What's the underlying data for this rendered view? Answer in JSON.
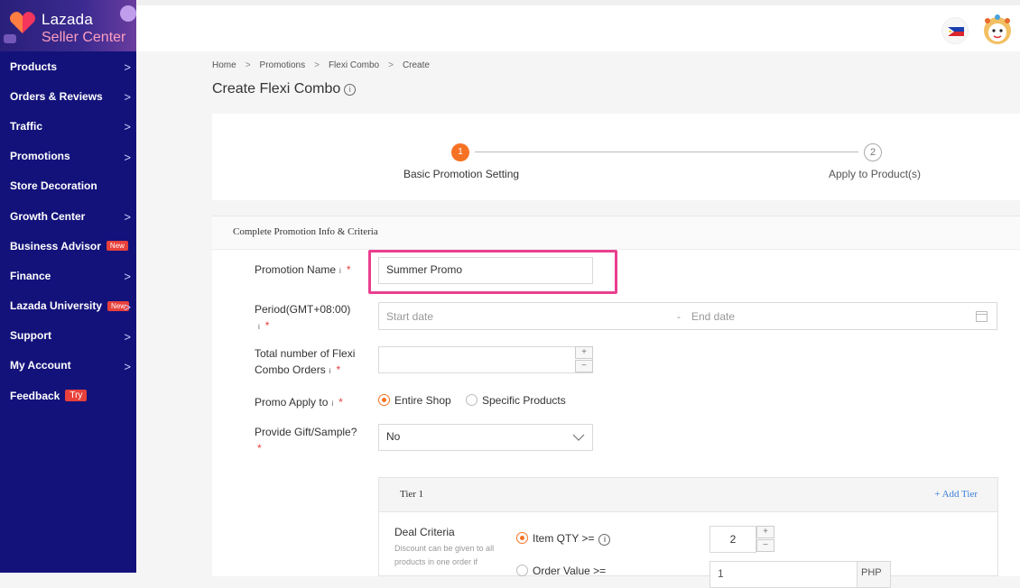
{
  "logo": {
    "line1": "Lazada",
    "line2": "Seller Center"
  },
  "sidebar": {
    "items": [
      {
        "label": "Products",
        "chevron": true
      },
      {
        "label": "Orders & Reviews",
        "chevron": true
      },
      {
        "label": "Traffic",
        "chevron": true
      },
      {
        "label": "Promotions",
        "chevron": true
      },
      {
        "label": "Store Decoration",
        "chevron": false
      },
      {
        "label": "Growth Center",
        "chevron": true
      },
      {
        "label": "Business Advisor",
        "chevron": false,
        "badge": "New"
      },
      {
        "label": "Finance",
        "chevron": true
      },
      {
        "label": "Lazada University",
        "chevron": true,
        "badge": "New"
      },
      {
        "label": "Support",
        "chevron": true
      },
      {
        "label": "My Account",
        "chevron": true
      },
      {
        "label": "Feedback",
        "chevron": false,
        "badge": "Try"
      }
    ]
  },
  "breadcrumb": [
    "Home",
    "Promotions",
    "Flexi Combo",
    "Create"
  ],
  "page_title": "Create Flexi Combo",
  "steps": {
    "step1": {
      "num": "1",
      "label": "Basic Promotion Setting"
    },
    "step2": {
      "num": "2",
      "label": "Apply to Product(s)"
    }
  },
  "form": {
    "section_title": "Complete Promotion Info & Criteria",
    "promotion_name": {
      "label": "Promotion Name",
      "value": "Summer Promo"
    },
    "period": {
      "label": "Period(GMT+08:00)",
      "start_placeholder": "Start date",
      "separator": "-",
      "end_placeholder": "End date"
    },
    "total_orders": {
      "label_line1": "Total number of Flexi",
      "label_line2": "Combo Orders",
      "value": ""
    },
    "promo_apply": {
      "label": "Promo Apply to",
      "options": [
        "Entire Shop",
        "Specific Products"
      ],
      "selected": "Entire Shop"
    },
    "gift": {
      "label": "Provide Gift/Sample?",
      "value": "No"
    },
    "tier": {
      "title": "Tier 1",
      "add_label": "+ Add Tier",
      "deal_criteria": "Deal Criteria",
      "hint_line1": "Discount can be given to all",
      "hint_line2": "products in one order if",
      "opt1": "Item QTY >=",
      "opt2": "Order Value >=",
      "qty_value": "2",
      "value_input": "1",
      "currency": "PHP"
    }
  },
  "icons": {
    "plus": "+",
    "minus": "−",
    "required": "*",
    "info": "i"
  },
  "colors": {
    "sidebar": "#13127a",
    "accent": "#f57224",
    "highlight": "#ea3f8e",
    "required": "#e8403b"
  }
}
